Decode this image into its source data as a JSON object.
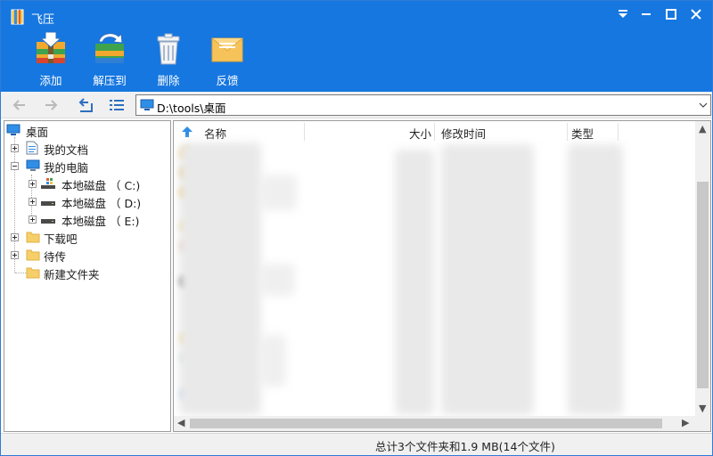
{
  "window": {
    "title": "飞压",
    "accent": "#1677e0"
  },
  "toolbar": {
    "add_label": "添加",
    "extract_label": "解压到",
    "delete_label": "删除",
    "feedback_label": "反馈"
  },
  "address": {
    "path": "D:\\tools\\桌面"
  },
  "tree": {
    "root": "桌面",
    "docs": "我的文档",
    "pc": "我的电脑",
    "drive_c": "本地磁盘 （ C:)",
    "drive_d": "本地磁盘 （ D:)",
    "drive_e": "本地磁盘 （ E:)",
    "downloads": "下载吧",
    "pending": "待传",
    "new_folder": "新建文件夹"
  },
  "list": {
    "col_name": "名称",
    "col_size": "大小",
    "col_modified": "修改时间",
    "col_type": "类型"
  },
  "status": {
    "summary": "总计3个文件夹和1.9 MB(14个文件)"
  }
}
